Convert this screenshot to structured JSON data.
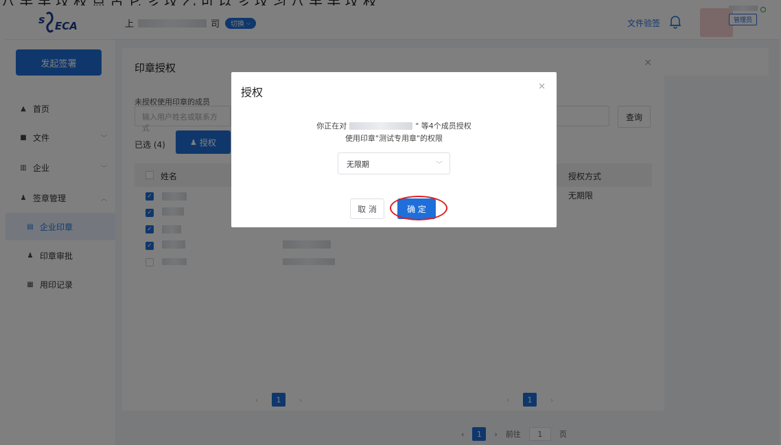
{
  "caption": {
    "text": "八 丰 丰 坟 权  点 古 它 彡 坟 乙  可 以 彡 坟 习 八 丰 丰 坟 权"
  },
  "header": {
    "company_prefix": "上",
    "company_suffix": "司",
    "switch_label": "切换",
    "verify_link": "文件验签",
    "role_badge": "管理员"
  },
  "sidebar": {
    "start_button": "发起签署",
    "items": [
      {
        "label": "首页",
        "icon": "home-icon"
      },
      {
        "label": "文件",
        "icon": "folder-icon"
      },
      {
        "label": "企业",
        "icon": "building-icon"
      },
      {
        "label": "签章管理",
        "icon": "user-icon"
      },
      {
        "label": "企业印章",
        "icon": "seal-icon"
      },
      {
        "label": "印章审批",
        "icon": "approval-icon"
      },
      {
        "label": "用印记录",
        "icon": "record-icon"
      }
    ]
  },
  "panel": {
    "title": "印章授权",
    "section_label": "未授权使用印章的成员",
    "search_placeholder": "输入用户姓名或联系方式",
    "query_button": "查询",
    "selected_count": "已选 (4)",
    "auth_button": "授权",
    "col_name": "姓名",
    "col_mode": "授权方式",
    "row_mode": "无期限",
    "page": "1"
  },
  "bottom_pager": {
    "goto": "前往",
    "page": "1",
    "unit": "页"
  },
  "dialog": {
    "title": "授权",
    "message_prefix": "你正在对",
    "message_suffix": "\" 等4个成员授权",
    "message_line2": "使用印章\"测试专用章\"的权限",
    "select_value": "无限期",
    "cancel": "取 消",
    "confirm": "确 定"
  },
  "colors": {
    "primary": "#1e6fd9",
    "highlight_ring": "#e11c1c"
  }
}
